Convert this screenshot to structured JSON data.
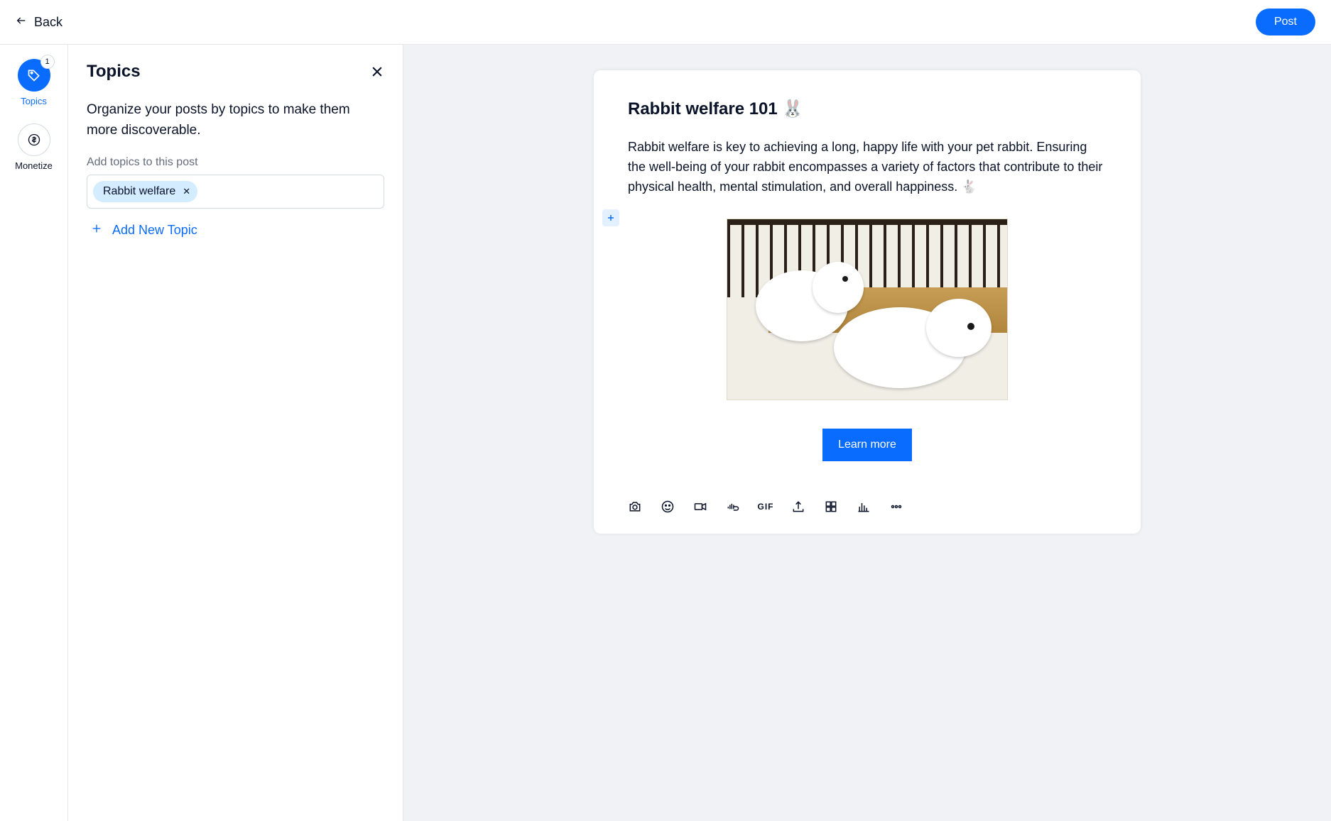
{
  "header": {
    "back_label": "Back",
    "post_label": "Post"
  },
  "sidebar": {
    "items": [
      {
        "id": "topics",
        "label": "Topics",
        "icon": "tag-icon",
        "badge": "1",
        "active": true
      },
      {
        "id": "monetize",
        "label": "Monetize",
        "icon": "dollar-icon",
        "active": false
      }
    ]
  },
  "panel": {
    "title": "Topics",
    "description": "Organize your posts by topics to make them more discoverable.",
    "field_label": "Add topics to this post",
    "chips": [
      {
        "label": "Rabbit welfare"
      }
    ],
    "add_new_label": "Add New Topic"
  },
  "post": {
    "title": "Rabbit welfare 101 🐰",
    "body": "Rabbit welfare is key to achieving a long, happy life with your pet rabbit. Ensuring the well-being of your rabbit encompasses a variety of factors that contribute to their physical health, mental stimulation, and overall happiness. 🐇",
    "learn_more_label": "Learn more",
    "image_alt": "Two white rabbits"
  },
  "toolbar": {
    "gif_label": "GIF"
  }
}
